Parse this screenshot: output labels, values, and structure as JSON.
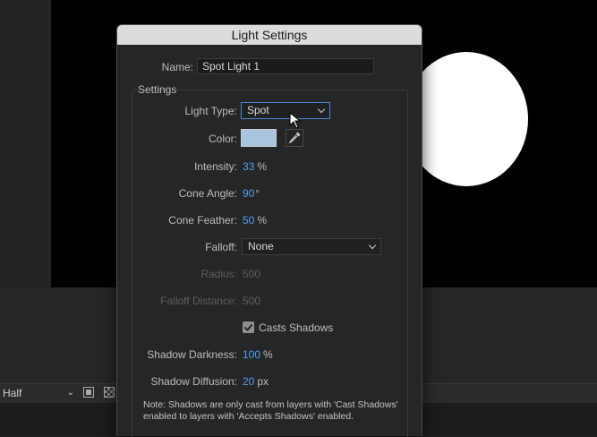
{
  "dialog": {
    "title": "Light Settings",
    "name_label": "Name:",
    "name_value": "Spot Light 1",
    "group_label": "Settings",
    "light_type": {
      "label": "Light Type:",
      "value": "Spot"
    },
    "color": {
      "label": "Color:",
      "swatch": "#a9c4de"
    },
    "intensity": {
      "label": "Intensity:",
      "value": "33",
      "unit": "%"
    },
    "cone_angle": {
      "label": "Cone Angle:",
      "value": "90",
      "unit": "°"
    },
    "cone_feather": {
      "label": "Cone Feather:",
      "value": "50",
      "unit": "%"
    },
    "falloff": {
      "label": "Falloff:",
      "value": "None"
    },
    "radius": {
      "label": "Radius:",
      "value": "500"
    },
    "falloff_distance": {
      "label": "Falloff Distance:",
      "value": "500"
    },
    "casts_shadows": {
      "label": "Casts Shadows",
      "checked": true
    },
    "shadow_darkness": {
      "label": "Shadow Darkness:",
      "value": "100",
      "unit": "%"
    },
    "shadow_diffusion": {
      "label": "Shadow Diffusion:",
      "value": "20",
      "unit": "px"
    },
    "note": "Note: Shadows are only cast from layers with 'Cast Shadows' enabled to layers with 'Accepts Shadows' enabled."
  },
  "viewer_toolbar": {
    "resolution": "Half"
  },
  "colors": {
    "accent_value": "#4d9ef7",
    "focus_border": "#4d84d6"
  }
}
